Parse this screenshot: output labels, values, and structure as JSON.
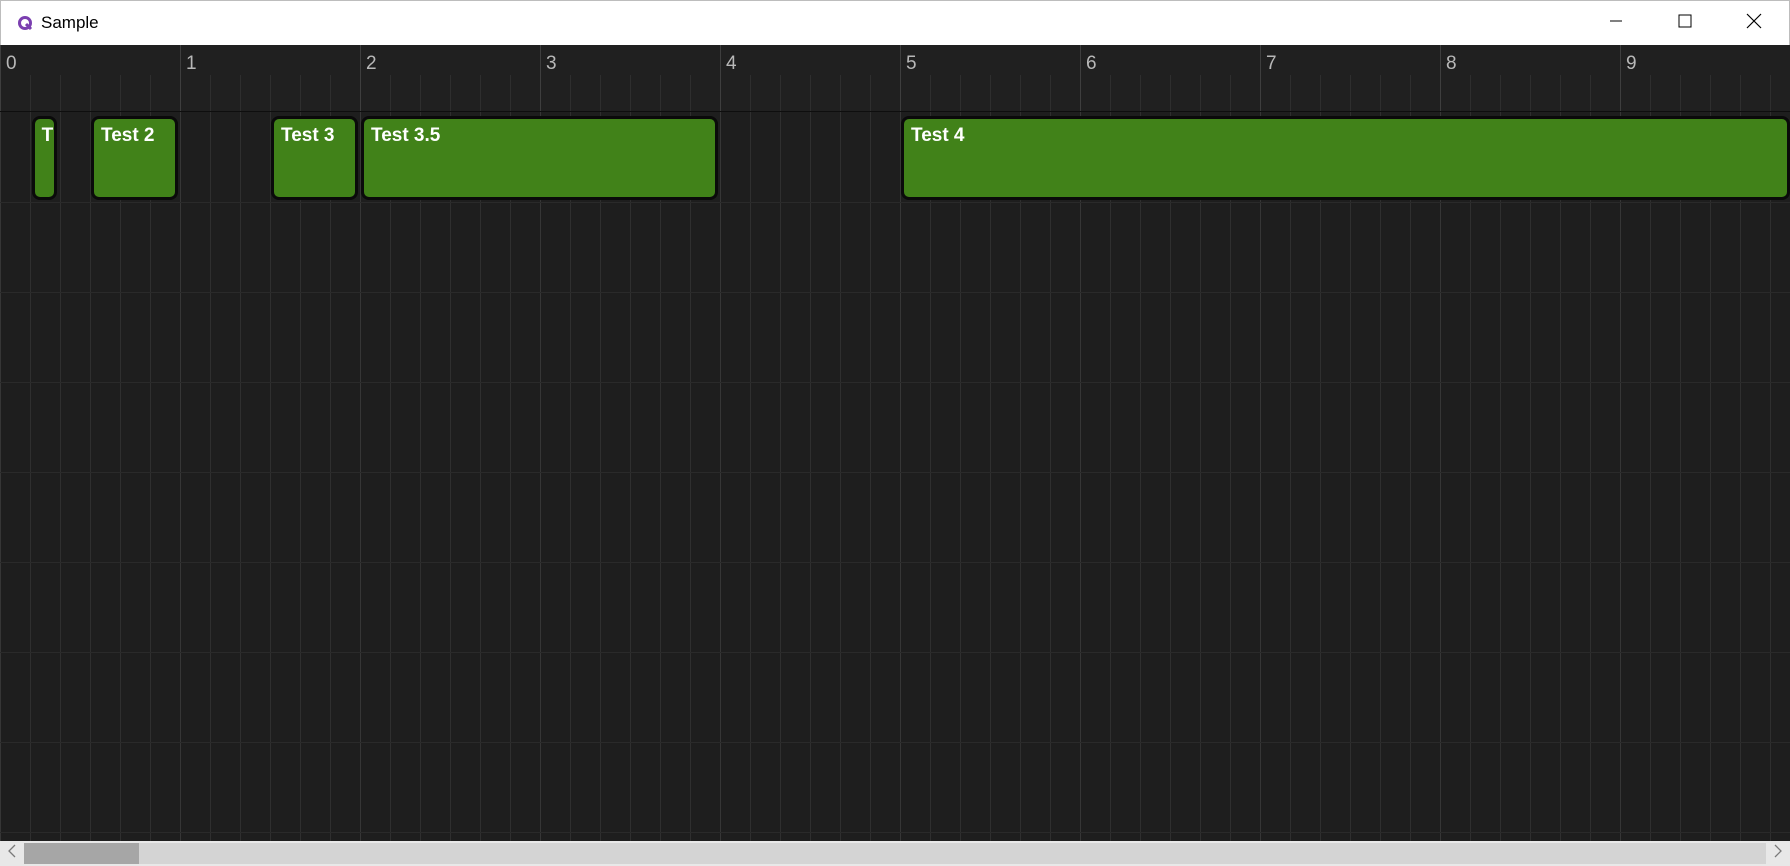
{
  "window": {
    "title": "Sample",
    "icons": {
      "app": "app-logo-icon",
      "minimize": "minimize-icon",
      "maximize": "maximize-icon",
      "close": "close-icon"
    }
  },
  "ruler": {
    "labels": [
      "0",
      "1",
      "2",
      "3",
      "4",
      "5",
      "6",
      "7",
      "8",
      "9"
    ],
    "visible_range": [
      0,
      9.95
    ],
    "subdivisions_per_unit": 6
  },
  "tracks": {
    "rows": 8,
    "clips": [
      {
        "label": "T",
        "start": 0.17,
        "end": 0.33,
        "row": 0
      },
      {
        "label": "Test 2",
        "start": 0.5,
        "end": 1.0,
        "row": 0
      },
      {
        "label": "Test 3",
        "start": 1.5,
        "end": 2.0,
        "row": 0
      },
      {
        "label": "Test 3.5",
        "start": 2.0,
        "end": 4.0,
        "row": 0
      },
      {
        "label": "Test 4",
        "start": 5.0,
        "end": 10.0,
        "row": 0
      }
    ]
  },
  "scrollbar": {
    "position": 0.0,
    "visible_fraction": 0.066,
    "icons": {
      "left": "chevron-left-icon",
      "right": "chevron-right-icon"
    }
  },
  "colors": {
    "clip_fill": "#418219",
    "clip_border": "#0a0a0a",
    "background": "#1e1e1e",
    "ruler_background": "#202020",
    "grid_line": "#2f2f2f"
  }
}
